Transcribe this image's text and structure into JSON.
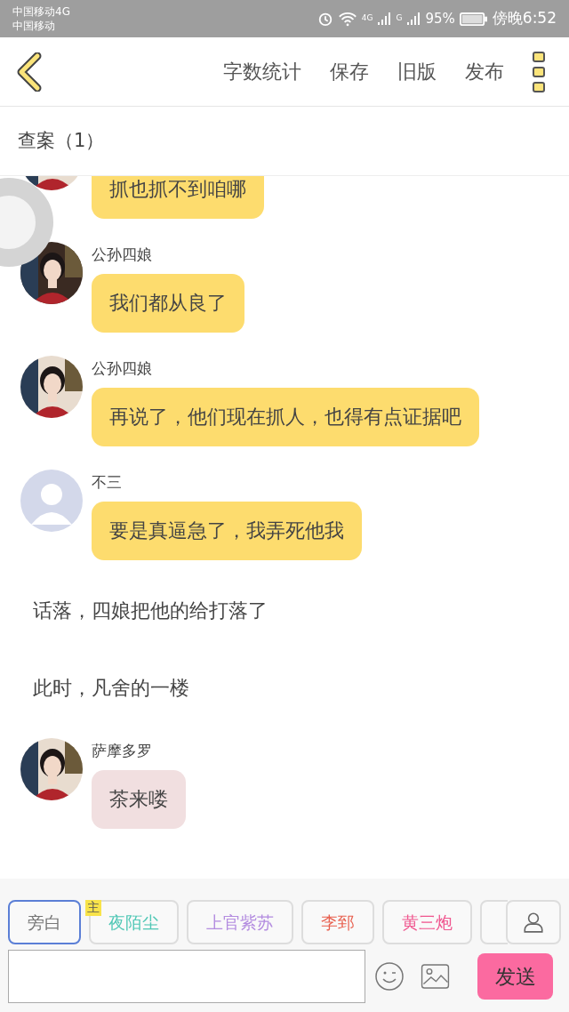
{
  "status_bar": {
    "carrier_1": "中国移动4G",
    "carrier_2": "中国移动",
    "net_1": "4G",
    "net_2": "G",
    "battery": "95%",
    "time": "傍晚6:52"
  },
  "toolbar": {
    "actions": [
      "字数统计",
      "保存",
      "旧版",
      "发布"
    ]
  },
  "chapter": {
    "title": "查案（1）"
  },
  "messages": [
    {
      "kind": "message",
      "text": "抓也抓不到咱哪",
      "color": "#fddc6e"
    },
    {
      "kind": "message",
      "name": "公孙四娘",
      "text": "我们都从良了",
      "color": "#fddc6e"
    },
    {
      "kind": "message",
      "name": "公孙四娘",
      "text": "再说了，他们现在抓人，也得有点证据吧",
      "color": "#fddc6e"
    },
    {
      "kind": "message",
      "name": "不三",
      "avatar": {
        "kind": "default"
      },
      "text": "要是真逼急了，我弄死他我",
      "color": "#fddc6e"
    },
    {
      "kind": "narration",
      "text": "话落，四娘把他的给打落了"
    },
    {
      "kind": "narration",
      "text": "此时，凡舍的一楼"
    },
    {
      "kind": "message",
      "name": "萨摩多罗",
      "text": "茶来喽",
      "color": "#f1dfe0"
    }
  ],
  "roles": [
    {
      "name": "旁白",
      "selected": true,
      "color": "#777777"
    },
    {
      "name": "夜陌尘",
      "selected": false,
      "color": "#4fc7b5",
      "badge": "主"
    },
    {
      "name": "上官紫苏",
      "selected": false,
      "color": "#b48de0"
    },
    {
      "name": "李郅",
      "selected": false,
      "color": "#e8604f"
    },
    {
      "name": "黄三炮",
      "selected": false,
      "color": "#f0568f"
    },
    {
      "selected": false
    }
  ],
  "composer": {
    "send": "发送"
  }
}
